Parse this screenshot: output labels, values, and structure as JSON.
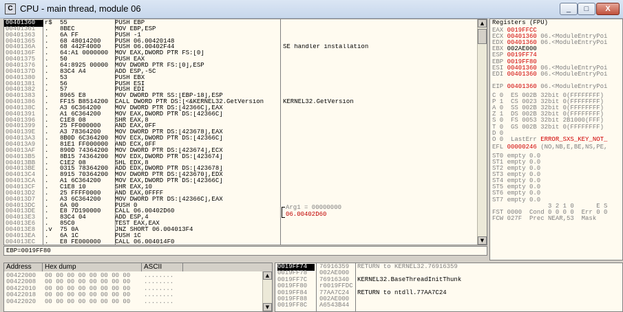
{
  "window": {
    "title": "CPU - main thread, module 06",
    "icon_label": "C",
    "buttons": {
      "minimize": "_",
      "maximize": "□",
      "close": "X"
    }
  },
  "disasm": {
    "rows": [
      {
        "addr": "00401360",
        "mark": "r$",
        "hex": "55",
        "asm": "PUSH EBP",
        "comment": "",
        "current": true
      },
      {
        "addr": "00401361",
        "mark": ".",
        "hex": "8BEC",
        "asm": "MOV EBP,ESP",
        "comment": ""
      },
      {
        "addr": "00401363",
        "mark": ".",
        "hex": "6A FF",
        "asm": "PUSH -1",
        "comment": ""
      },
      {
        "addr": "00401365",
        "mark": ".",
        "hex": "68 48014200",
        "asm": "PUSH 06.00420148",
        "comment": ""
      },
      {
        "addr": "0040136A",
        "mark": ".",
        "hex": "68 442F4000",
        "asm": "PUSH 06.00402F44",
        "comment": "SE handler installation"
      },
      {
        "addr": "0040136F",
        "mark": ".",
        "hex": "64:A1 0000000",
        "asm": "MOV EAX,DWORD PTR FS:[0]",
        "comment": ""
      },
      {
        "addr": "00401375",
        "mark": ".",
        "hex": "50",
        "asm": "PUSH EAX",
        "comment": ""
      },
      {
        "addr": "00401376",
        "mark": ".",
        "hex": "64:8925 00000",
        "asm": "MOV DWORD PTR FS:[0],ESP",
        "comment": ""
      },
      {
        "addr": "0040137D",
        "mark": ".",
        "hex": "83C4 A4",
        "asm": "ADD ESP,-5C",
        "comment": ""
      },
      {
        "addr": "00401380",
        "mark": ".",
        "hex": "53",
        "asm": "PUSH EBX",
        "comment": ""
      },
      {
        "addr": "00401381",
        "mark": ".",
        "hex": "56",
        "asm": "PUSH ESI",
        "comment": ""
      },
      {
        "addr": "00401382",
        "mark": ".",
        "hex": "57",
        "asm": "PUSH EDI",
        "comment": ""
      },
      {
        "addr": "00401383",
        "mark": ".",
        "hex": "8965 E8",
        "asm": "MOV DWORD PTR SS:[EBP-18],ESP",
        "comment": ""
      },
      {
        "addr": "00401386",
        "mark": ".",
        "hex": "FF15 B8514200",
        "asm": "CALL DWORD PTR DS:[<&KERNEL32.GetVersion",
        "comment": "KERNEL32.GetVersion"
      },
      {
        "addr": "0040138C",
        "mark": ".",
        "hex": "A3 6C364200",
        "asm": "MOV DWORD PTR DS:[42366C],EAX",
        "comment": ""
      },
      {
        "addr": "00401391",
        "mark": ".",
        "hex": "A1 6C364200",
        "asm": "MOV EAX,DWORD PTR DS:[42366C]",
        "comment": ""
      },
      {
        "addr": "00401396",
        "mark": ".",
        "hex": "C1E8 08",
        "asm": "SHR EAX,8",
        "comment": ""
      },
      {
        "addr": "00401399",
        "mark": ".",
        "hex": "25 FF000000",
        "asm": "AND EAX,0FF",
        "comment": ""
      },
      {
        "addr": "0040139E",
        "mark": ".",
        "hex": "A3 78364200",
        "asm": "MOV DWORD PTR DS:[423678],EAX",
        "comment": ""
      },
      {
        "addr": "004013A3",
        "mark": ".",
        "hex": "8B0D 6C364200",
        "asm": "MOV ECX,DWORD PTR DS:[42366C]",
        "comment": ""
      },
      {
        "addr": "004013A9",
        "mark": ".",
        "hex": "81E1 FF000000",
        "asm": "AND ECX,0FF",
        "comment": ""
      },
      {
        "addr": "004013AF",
        "mark": ".",
        "hex": "890D 74364200",
        "asm": "MOV DWORD PTR DS:[423674],ECX",
        "comment": ""
      },
      {
        "addr": "004013B5",
        "mark": ".",
        "hex": "8B15 74364200",
        "asm": "MOV EDX,DWORD PTR DS:[423674]",
        "comment": ""
      },
      {
        "addr": "004013BB",
        "mark": ".",
        "hex": "C1E2 08",
        "asm": "SHL EDX,8",
        "comment": ""
      },
      {
        "addr": "004013BE",
        "mark": ".",
        "hex": "0315 78364200",
        "asm": "ADD EDX,DWORD PTR DS:[423678]",
        "comment": ""
      },
      {
        "addr": "004013C4",
        "mark": ".",
        "hex": "8915 70364200",
        "asm": "MOV DWORD PTR DS:[423670],EDX",
        "comment": ""
      },
      {
        "addr": "004013CA",
        "mark": ".",
        "hex": "A1 6C364200",
        "asm": "MOV EAX,DWORD PTR DS:[42366C]",
        "comment": ""
      },
      {
        "addr": "004013CF",
        "mark": ".",
        "hex": "C1E8 10",
        "asm": "SHR EAX,10",
        "comment": ""
      },
      {
        "addr": "004013D2",
        "mark": ".",
        "hex": "25 FFFF0000",
        "asm": "AND EAX,0FFFF",
        "comment": ""
      },
      {
        "addr": "004013D7",
        "mark": ".",
        "hex": "A3 6C364200",
        "asm": "MOV DWORD PTR DS:[42366C],EAX",
        "comment": ""
      },
      {
        "addr": "004013DC",
        "mark": ".",
        "hex": "6A 00",
        "asm": "PUSH 0",
        "comment": ""
      },
      {
        "addr": "004013DE",
        "mark": ".",
        "hex": "E8 7D190000",
        "asm": "CALL 06.00402D60",
        "comment": ""
      },
      {
        "addr": "004013E3",
        "mark": ".",
        "hex": "83C4 04",
        "asm": "ADD ESP,4",
        "comment": ""
      },
      {
        "addr": "004013E6",
        "mark": ".",
        "hex": "85C0",
        "asm": "TEST EAX,EAX",
        "comment": ""
      },
      {
        "addr": "004013E8",
        "mark": ".v",
        "hex": "75 0A",
        "asm": "JNZ SHORT 06.004013F4",
        "comment": ""
      },
      {
        "addr": "004013EA",
        "mark": ".",
        "hex": "6A 1C",
        "asm": "PUSH 1C",
        "comment": ""
      },
      {
        "addr": "004013EC",
        "mark": ".",
        "hex": "E8 FE000000",
        "asm": "CALL 06.004014F0",
        "comment": ""
      }
    ],
    "arg_line1": "Arg1 = 00000000",
    "arg_line2": "06.00402D60"
  },
  "info": {
    "text": "EBP=0019FF80"
  },
  "registers": {
    "header": "Registers (FPU)",
    "lines": [
      {
        "name": "EAX",
        "value": "0019FFCC",
        "comment": "",
        "red": true
      },
      {
        "name": "ECX",
        "value": "00401360",
        "comment": "06.<ModuleEntryPoi",
        "red": true
      },
      {
        "name": "EDX",
        "value": "00401360",
        "comment": "06.<ModuleEntryPoi",
        "red": true
      },
      {
        "name": "EBX",
        "value": "002AE000",
        "comment": "",
        "red": false
      },
      {
        "name": "ESP",
        "value": "0019FF74",
        "comment": "",
        "red": true
      },
      {
        "name": "EBP",
        "value": "0019FF80",
        "comment": "",
        "red": true
      },
      {
        "name": "ESI",
        "value": "00401360",
        "comment": "06.<ModuleEntryPoi",
        "red": true
      },
      {
        "name": "EDI",
        "value": "00401360",
        "comment": "06.<ModuleEntryPoi",
        "red": true
      },
      {
        "name": "",
        "value": "",
        "comment": "",
        "red": false
      },
      {
        "name": "EIP",
        "value": "00401360",
        "comment": "06.<ModuleEntryPoi",
        "red": true
      }
    ],
    "flags": [
      "C 0  ES 002B 32bit 0(FFFFFFFF)",
      "P 1  CS 0023 32bit 0(FFFFFFFF)",
      "A 0  SS 002B 32bit 0(FFFFFFFF)",
      "Z 1  DS 002B 32bit 0(FFFFFFFF)",
      "S 0  FS 0053 32bit 2B1000(FFF)",
      "T 0  GS 002B 32bit 0(FFFFFFFF)",
      "D 0",
      "O 0  LastErr ERROR_SXS_KEY_NOT_"
    ],
    "efl": {
      "label": "EFL",
      "value": "00000246",
      "comment": "(NO,NB,E,BE,NS,PE,"
    },
    "fpu": [
      "ST0 empty 0.0",
      "ST1 empty 0.0",
      "ST2 empty 0.0",
      "ST3 empty 0.0",
      "ST4 empty 0.0",
      "ST5 empty 0.0",
      "ST6 empty 0.0",
      "ST7 empty 0.0"
    ],
    "fst_head": "               3 2 1 0      E S",
    "fst": "FST 0000  Cond 0 0 0 0  Err 0 0",
    "fcw": "FCW 027F  Prec NEAR,53  Mask"
  },
  "dump": {
    "headers": {
      "address": "Address",
      "hex": "Hex dump",
      "ascii": "ASCII"
    },
    "rows": [
      {
        "addr": "00422000",
        "hex": "00 00 00 00 00 00 00 00",
        "ascii": "........"
      },
      {
        "addr": "00422008",
        "hex": "00 00 00 00 00 00 00 00",
        "ascii": "........"
      },
      {
        "addr": "00422010",
        "hex": "00 00 00 00 00 00 00 00",
        "ascii": "........"
      },
      {
        "addr": "00422018",
        "hex": "00 00 00 00 00 00 00 00",
        "ascii": "........"
      },
      {
        "addr": "00422020",
        "hex": "00 00 00 00 00 00 00 00",
        "ascii": "........"
      }
    ]
  },
  "stack": {
    "rows": [
      {
        "addr": "0019FF74",
        "value": "76916359",
        "comment": "RETURN to KERNEL32.76916359",
        "current": true,
        "grey": true
      },
      {
        "addr": "0019FF78",
        "value": "002AE000",
        "comment": "",
        "grey": false
      },
      {
        "addr": "0019FF7C",
        "value": "76916340",
        "comment": "KERNEL32.BaseThreadInitThunk",
        "grey": false
      },
      {
        "addr": "0019FF80",
        "value": "r0019FFDC",
        "comment": "",
        "grey": false
      },
      {
        "addr": "0019FF84",
        "value": "77AA7C24",
        "comment": "RETURN to ntdll.77AA7C24",
        "grey": false
      },
      {
        "addr": "0019FF88",
        "value": "002AE000",
        "comment": "",
        "grey": false
      },
      {
        "addr": "0019FF8C",
        "value": "A6543B44",
        "comment": "",
        "grey": false
      }
    ]
  }
}
